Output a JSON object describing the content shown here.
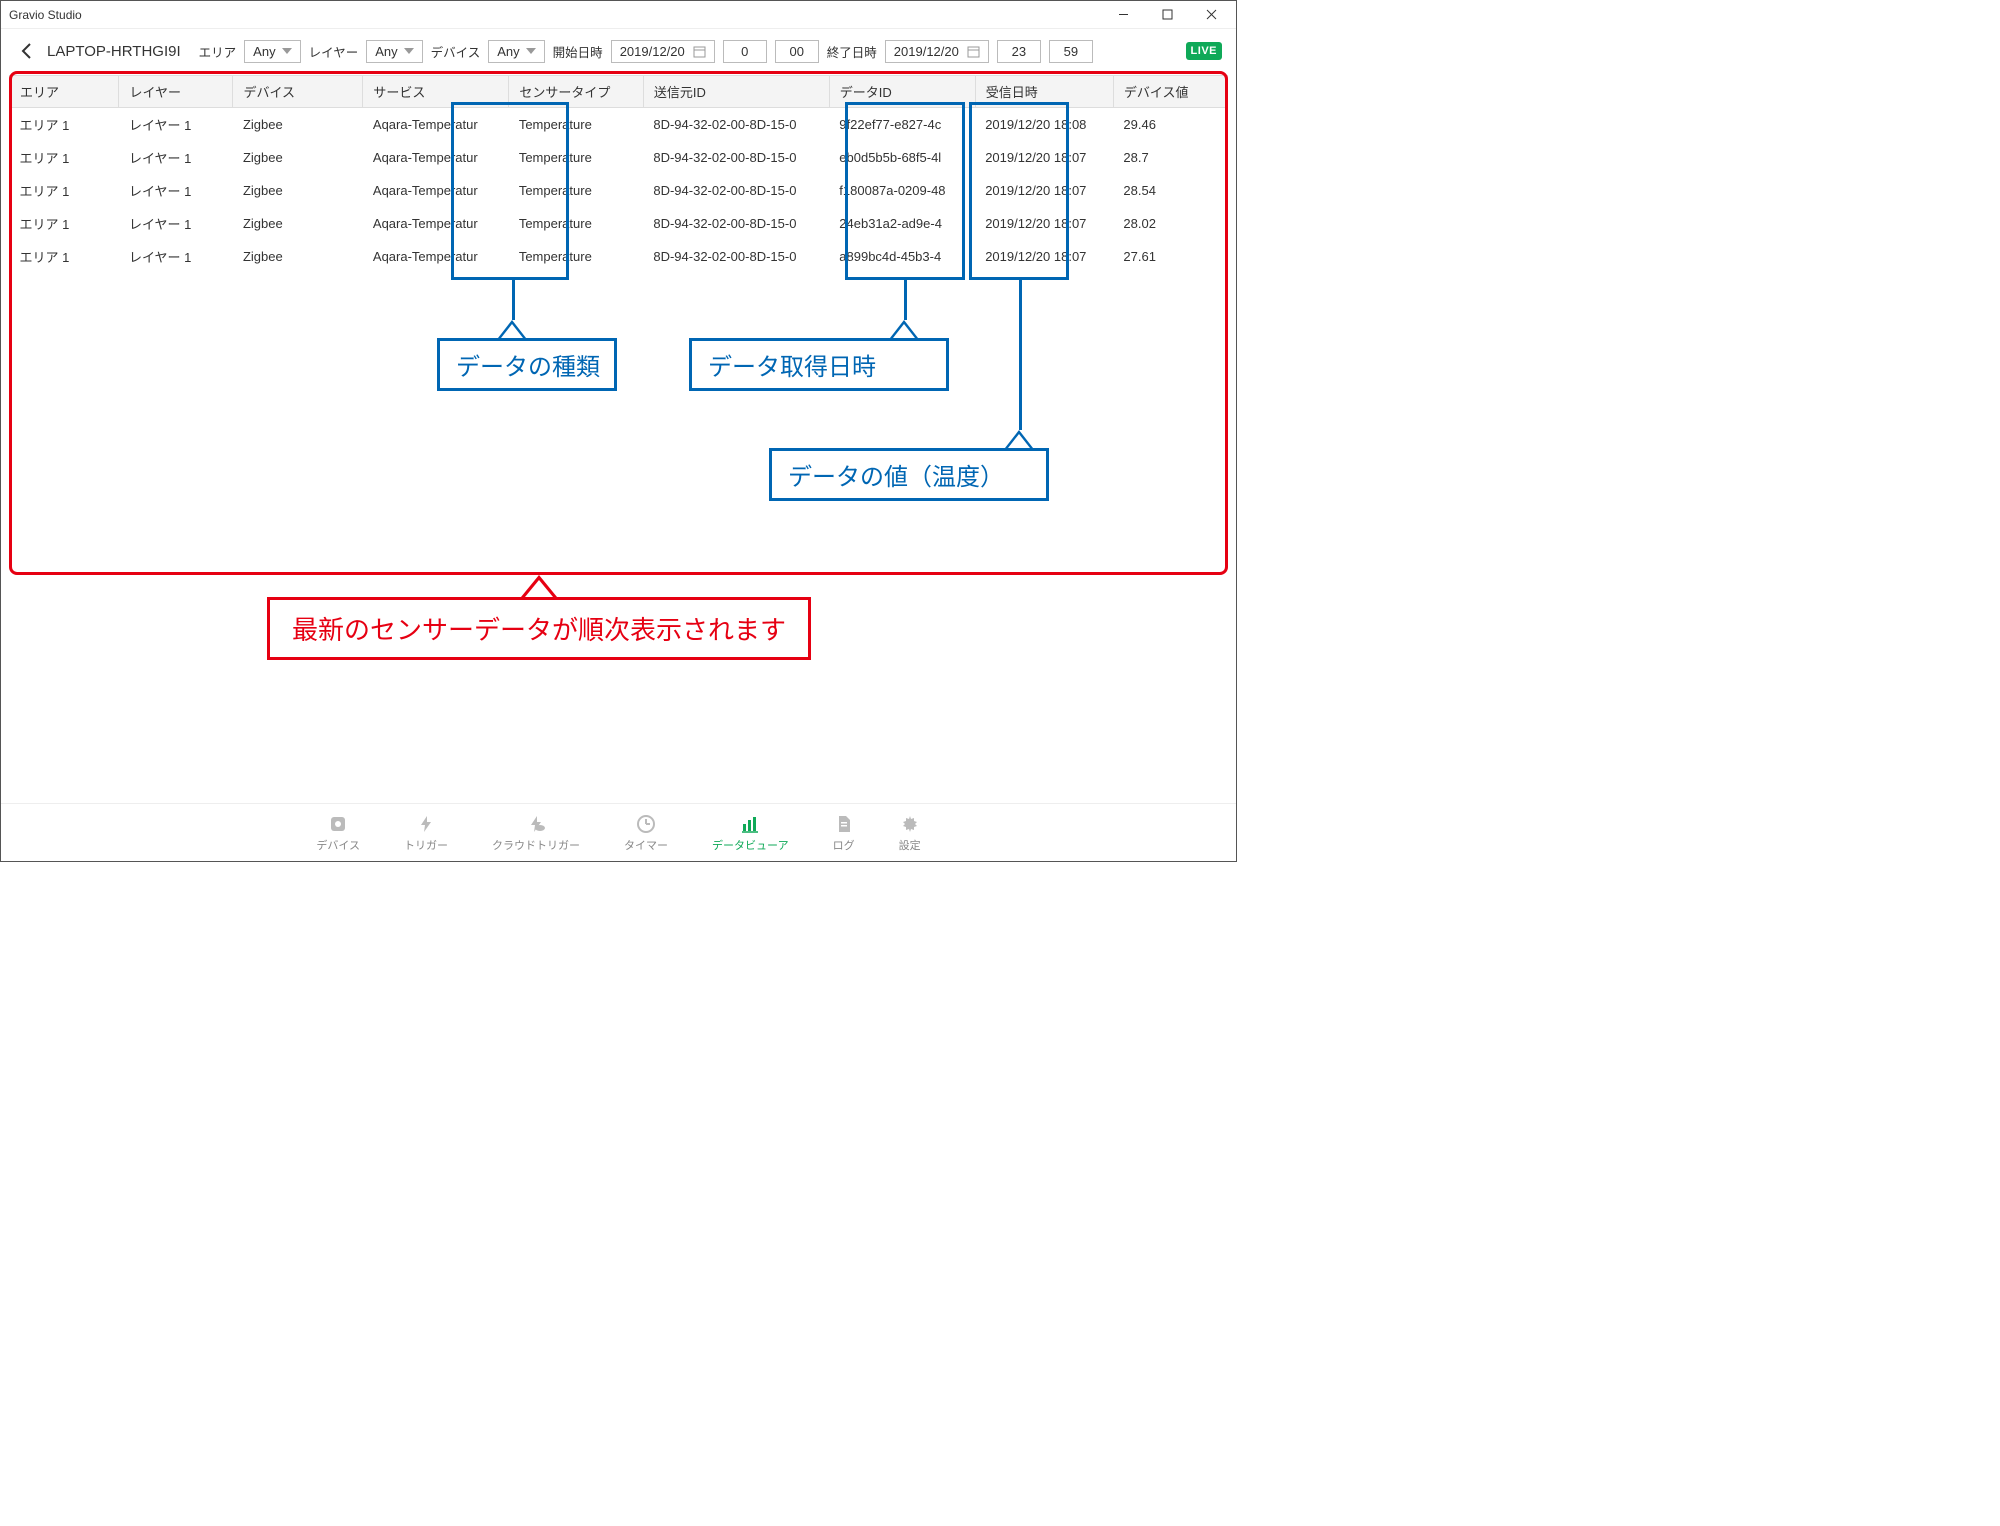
{
  "window": {
    "title": "Gravio Studio"
  },
  "toolbar": {
    "computer_name": "LAPTOP-HRTHGI9I",
    "area_label": "エリア",
    "area_value": "Any",
    "layer_label": "レイヤー",
    "layer_value": "Any",
    "device_label": "デバイス",
    "device_value": "Any",
    "start_label": "開始日時",
    "start_date": "2019/12/20",
    "start_h": "0",
    "start_m": "00",
    "end_label": "終了日時",
    "end_date": "2019/12/20",
    "end_h": "23",
    "end_m": "59",
    "live": "LIVE"
  },
  "columns": {
    "area": "エリア",
    "layer": "レイヤー",
    "device": "デバイス",
    "service": "サービス",
    "sensor": "センサータイプ",
    "sender": "送信元ID",
    "dataid": "データID",
    "recv": "受信日時",
    "val": "デバイス値"
  },
  "rows": [
    {
      "area": "エリア 1",
      "layer": "レイヤー 1",
      "device": "Zigbee",
      "service": "Aqara-Temperatur",
      "sensor": "Temperature",
      "sender": "8D-94-32-02-00-8D-15-0",
      "dataid": "9f22ef77-e827-4c",
      "recv": "2019/12/20 18:08",
      "val": "29.46"
    },
    {
      "area": "エリア 1",
      "layer": "レイヤー 1",
      "device": "Zigbee",
      "service": "Aqara-Temperatur",
      "sensor": "Temperature",
      "sender": "8D-94-32-02-00-8D-15-0",
      "dataid": "eb0d5b5b-68f5-4l",
      "recv": "2019/12/20 18:07",
      "val": "28.7"
    },
    {
      "area": "エリア 1",
      "layer": "レイヤー 1",
      "device": "Zigbee",
      "service": "Aqara-Temperatur",
      "sensor": "Temperature",
      "sender": "8D-94-32-02-00-8D-15-0",
      "dataid": "f180087a-0209-48",
      "recv": "2019/12/20 18:07",
      "val": "28.54"
    },
    {
      "area": "エリア 1",
      "layer": "レイヤー 1",
      "device": "Zigbee",
      "service": "Aqara-Temperatur",
      "sensor": "Temperature",
      "sender": "8D-94-32-02-00-8D-15-0",
      "dataid": "24eb31a2-ad9e-4",
      "recv": "2019/12/20 18:07",
      "val": "28.02"
    },
    {
      "area": "エリア 1",
      "layer": "レイヤー 1",
      "device": "Zigbee",
      "service": "Aqara-Temperatur",
      "sensor": "Temperature",
      "sender": "8D-94-32-02-00-8D-15-0",
      "dataid": "a899bc4d-45b3-4",
      "recv": "2019/12/20 18:07",
      "val": "27.61"
    }
  ],
  "callouts": {
    "type": "データの種類",
    "datetime": "データ取得日時",
    "value": "データの値（温度）",
    "main": "最新のセンサーデータが順次表示されます"
  },
  "nav": {
    "device": "デバイス",
    "trigger": "トリガー",
    "cloud": "クラウドトリガー",
    "timer": "タイマー",
    "viewer": "データビューア",
    "log": "ログ",
    "settings": "設定"
  }
}
